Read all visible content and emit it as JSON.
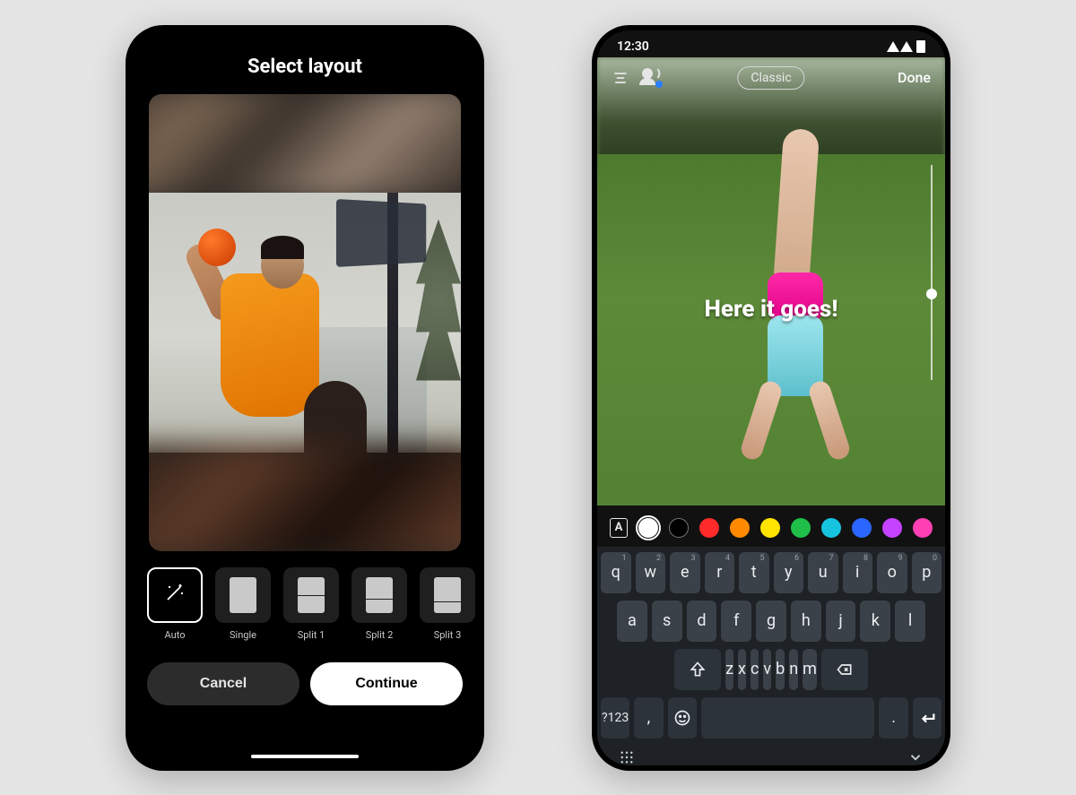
{
  "left": {
    "title": "Select layout",
    "layouts": [
      {
        "label": "Auto"
      },
      {
        "label": "Single"
      },
      {
        "label": "Split 1"
      },
      {
        "label": "Split 2"
      },
      {
        "label": "Split 3"
      }
    ],
    "selected_layout_index": 0,
    "cancel": "Cancel",
    "continue": "Continue"
  },
  "right": {
    "status_time": "12:30",
    "style_pill": "Classic",
    "done": "Done",
    "overlay_text": "Here it goes!",
    "text_style_glyph": "A",
    "colors": [
      "#ffffff",
      "#000000",
      "#ff2a2a",
      "#ff8a00",
      "#ffe400",
      "#1fbf4a",
      "#16c4e0",
      "#2a66ff",
      "#c542ff",
      "#ff3fb3"
    ],
    "selected_color_index": 0,
    "keyboard": {
      "row1": [
        {
          "k": "q",
          "h": "1"
        },
        {
          "k": "w",
          "h": "2"
        },
        {
          "k": "e",
          "h": "3"
        },
        {
          "k": "r",
          "h": "4"
        },
        {
          "k": "t",
          "h": "5"
        },
        {
          "k": "y",
          "h": "6"
        },
        {
          "k": "u",
          "h": "7"
        },
        {
          "k": "i",
          "h": "8"
        },
        {
          "k": "o",
          "h": "9"
        },
        {
          "k": "p",
          "h": "0"
        }
      ],
      "row2": [
        "a",
        "s",
        "d",
        "f",
        "g",
        "h",
        "j",
        "k",
        "l"
      ],
      "row3": [
        "z",
        "x",
        "c",
        "v",
        "b",
        "n",
        "m"
      ],
      "numkey": "?123",
      "comma": ",",
      "period": "."
    }
  }
}
